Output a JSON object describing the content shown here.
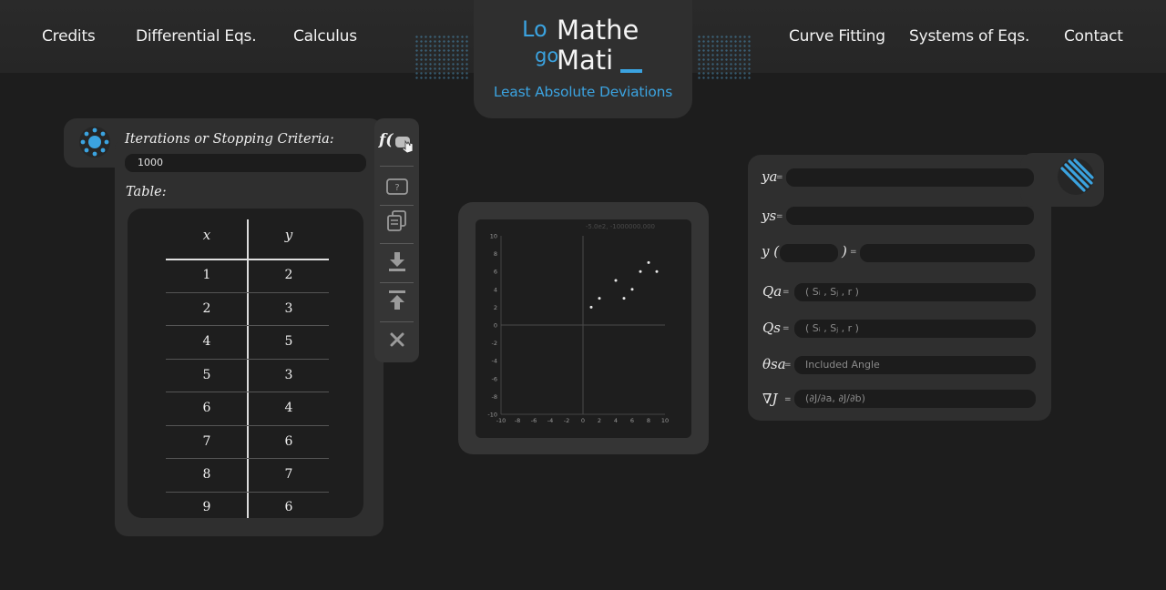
{
  "nav": {
    "left": [
      "Credits",
      "Differential Eqs.",
      "Calculus"
    ],
    "right": [
      "Curve Fitting",
      "Systems of Eqs.",
      "Contact"
    ]
  },
  "logo": {
    "lo": "Lo",
    "go": "go",
    "mathe": "Mathe",
    "mati": "Mati",
    "subtitle": "Least Absolute Deviations"
  },
  "left_panel": {
    "iterations_label": "Iterations or Stopping Criteria:",
    "iterations_value": "1000",
    "table_label": "Table:",
    "table": {
      "headers": [
        "x",
        "y"
      ],
      "rows": [
        [
          "1",
          "2"
        ],
        [
          "2",
          "3"
        ],
        [
          "4",
          "5"
        ],
        [
          "5",
          "3"
        ],
        [
          "6",
          "4"
        ],
        [
          "7",
          "6"
        ],
        [
          "8",
          "7"
        ],
        [
          "9",
          "6"
        ]
      ]
    }
  },
  "toolbar": {
    "function_label": "f(",
    "icons": [
      "function-icon",
      "help-icon",
      "copy-icon",
      "import-icon",
      "export-icon",
      "clear-icon"
    ]
  },
  "graph": {
    "coord_readout": "-5.0e2, -1000000.000",
    "axis_ticks": [
      "-10",
      "-8",
      "-6",
      "-4",
      "-2",
      "0",
      "2",
      "4",
      "6",
      "8",
      "10"
    ]
  },
  "right_panel": {
    "ya_label": "ya",
    "ys_label": "ys",
    "y_label": "y (",
    "y_close": ")",
    "qa_label": "Qa",
    "qs_label": "Qs",
    "theta_label": "θsa",
    "grad_label": "∇J",
    "qa_placeholder": "( Sᵢ , Sⱼ , r )",
    "qs_placeholder": "( Sᵢ , Sⱼ , r )",
    "theta_placeholder": "Included Angle",
    "grad_placeholder": "(∂J/∂a, ∂J/∂b)",
    "eq": "="
  },
  "colors": {
    "accent": "#3ba3e0",
    "background": "#1d1d1d",
    "panel": "#2f2f2f"
  },
  "chart_data": {
    "type": "scatter",
    "xlim": [
      -10,
      10
    ],
    "ylim": [
      -10,
      10
    ],
    "ticks": [
      -10,
      -8,
      -6,
      -4,
      -2,
      0,
      2,
      4,
      6,
      8,
      10
    ],
    "grid": false,
    "points": [
      {
        "x": 1,
        "y": 2
      },
      {
        "x": 2,
        "y": 3
      },
      {
        "x": 4,
        "y": 5
      },
      {
        "x": 5,
        "y": 3
      },
      {
        "x": 6,
        "y": 4
      },
      {
        "x": 7,
        "y": 6
      },
      {
        "x": 8,
        "y": 7
      },
      {
        "x": 9,
        "y": 6
      }
    ]
  }
}
